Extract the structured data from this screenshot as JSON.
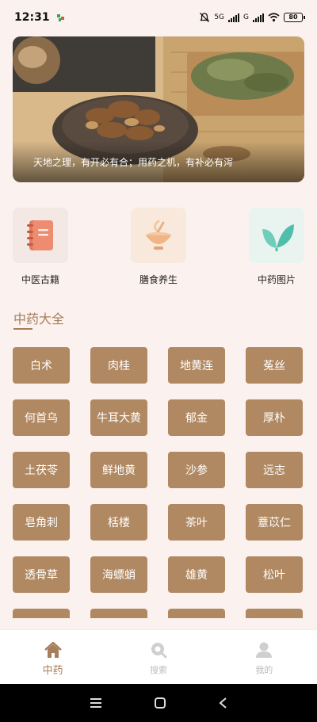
{
  "status_bar": {
    "time": "12:31",
    "network": "5G",
    "network2": "G",
    "battery": "80"
  },
  "banner": {
    "caption": "天地之理，有开必有合；用药之机，有补必有泻"
  },
  "quick_links": [
    {
      "label": "中医古籍",
      "icon": "book-icon"
    },
    {
      "label": "膳食养生",
      "icon": "bowl-icon"
    },
    {
      "label": "中药图片",
      "icon": "leaf-icon"
    }
  ],
  "section": {
    "title": "中药大全"
  },
  "herbs": [
    "白术",
    "肉桂",
    "地黄连",
    "菟丝",
    "何首乌",
    "牛耳大黄",
    "郁金",
    "厚朴",
    "土茯苓",
    "鲜地黄",
    "沙参",
    "远志",
    "皂角刺",
    "栝楼",
    "茶叶",
    "薏苡仁",
    "透骨草",
    "海螵蛸",
    "雄黄",
    "松叶"
  ],
  "tabs": [
    {
      "label": "中药",
      "icon": "home-icon",
      "active": true
    },
    {
      "label": "搜索",
      "icon": "search-icon",
      "active": false
    },
    {
      "label": "我的",
      "icon": "user-icon",
      "active": false
    }
  ],
  "colors": {
    "accent": "#a57f5a",
    "herb_button": "#b08962",
    "background": "#fbf1ee"
  }
}
